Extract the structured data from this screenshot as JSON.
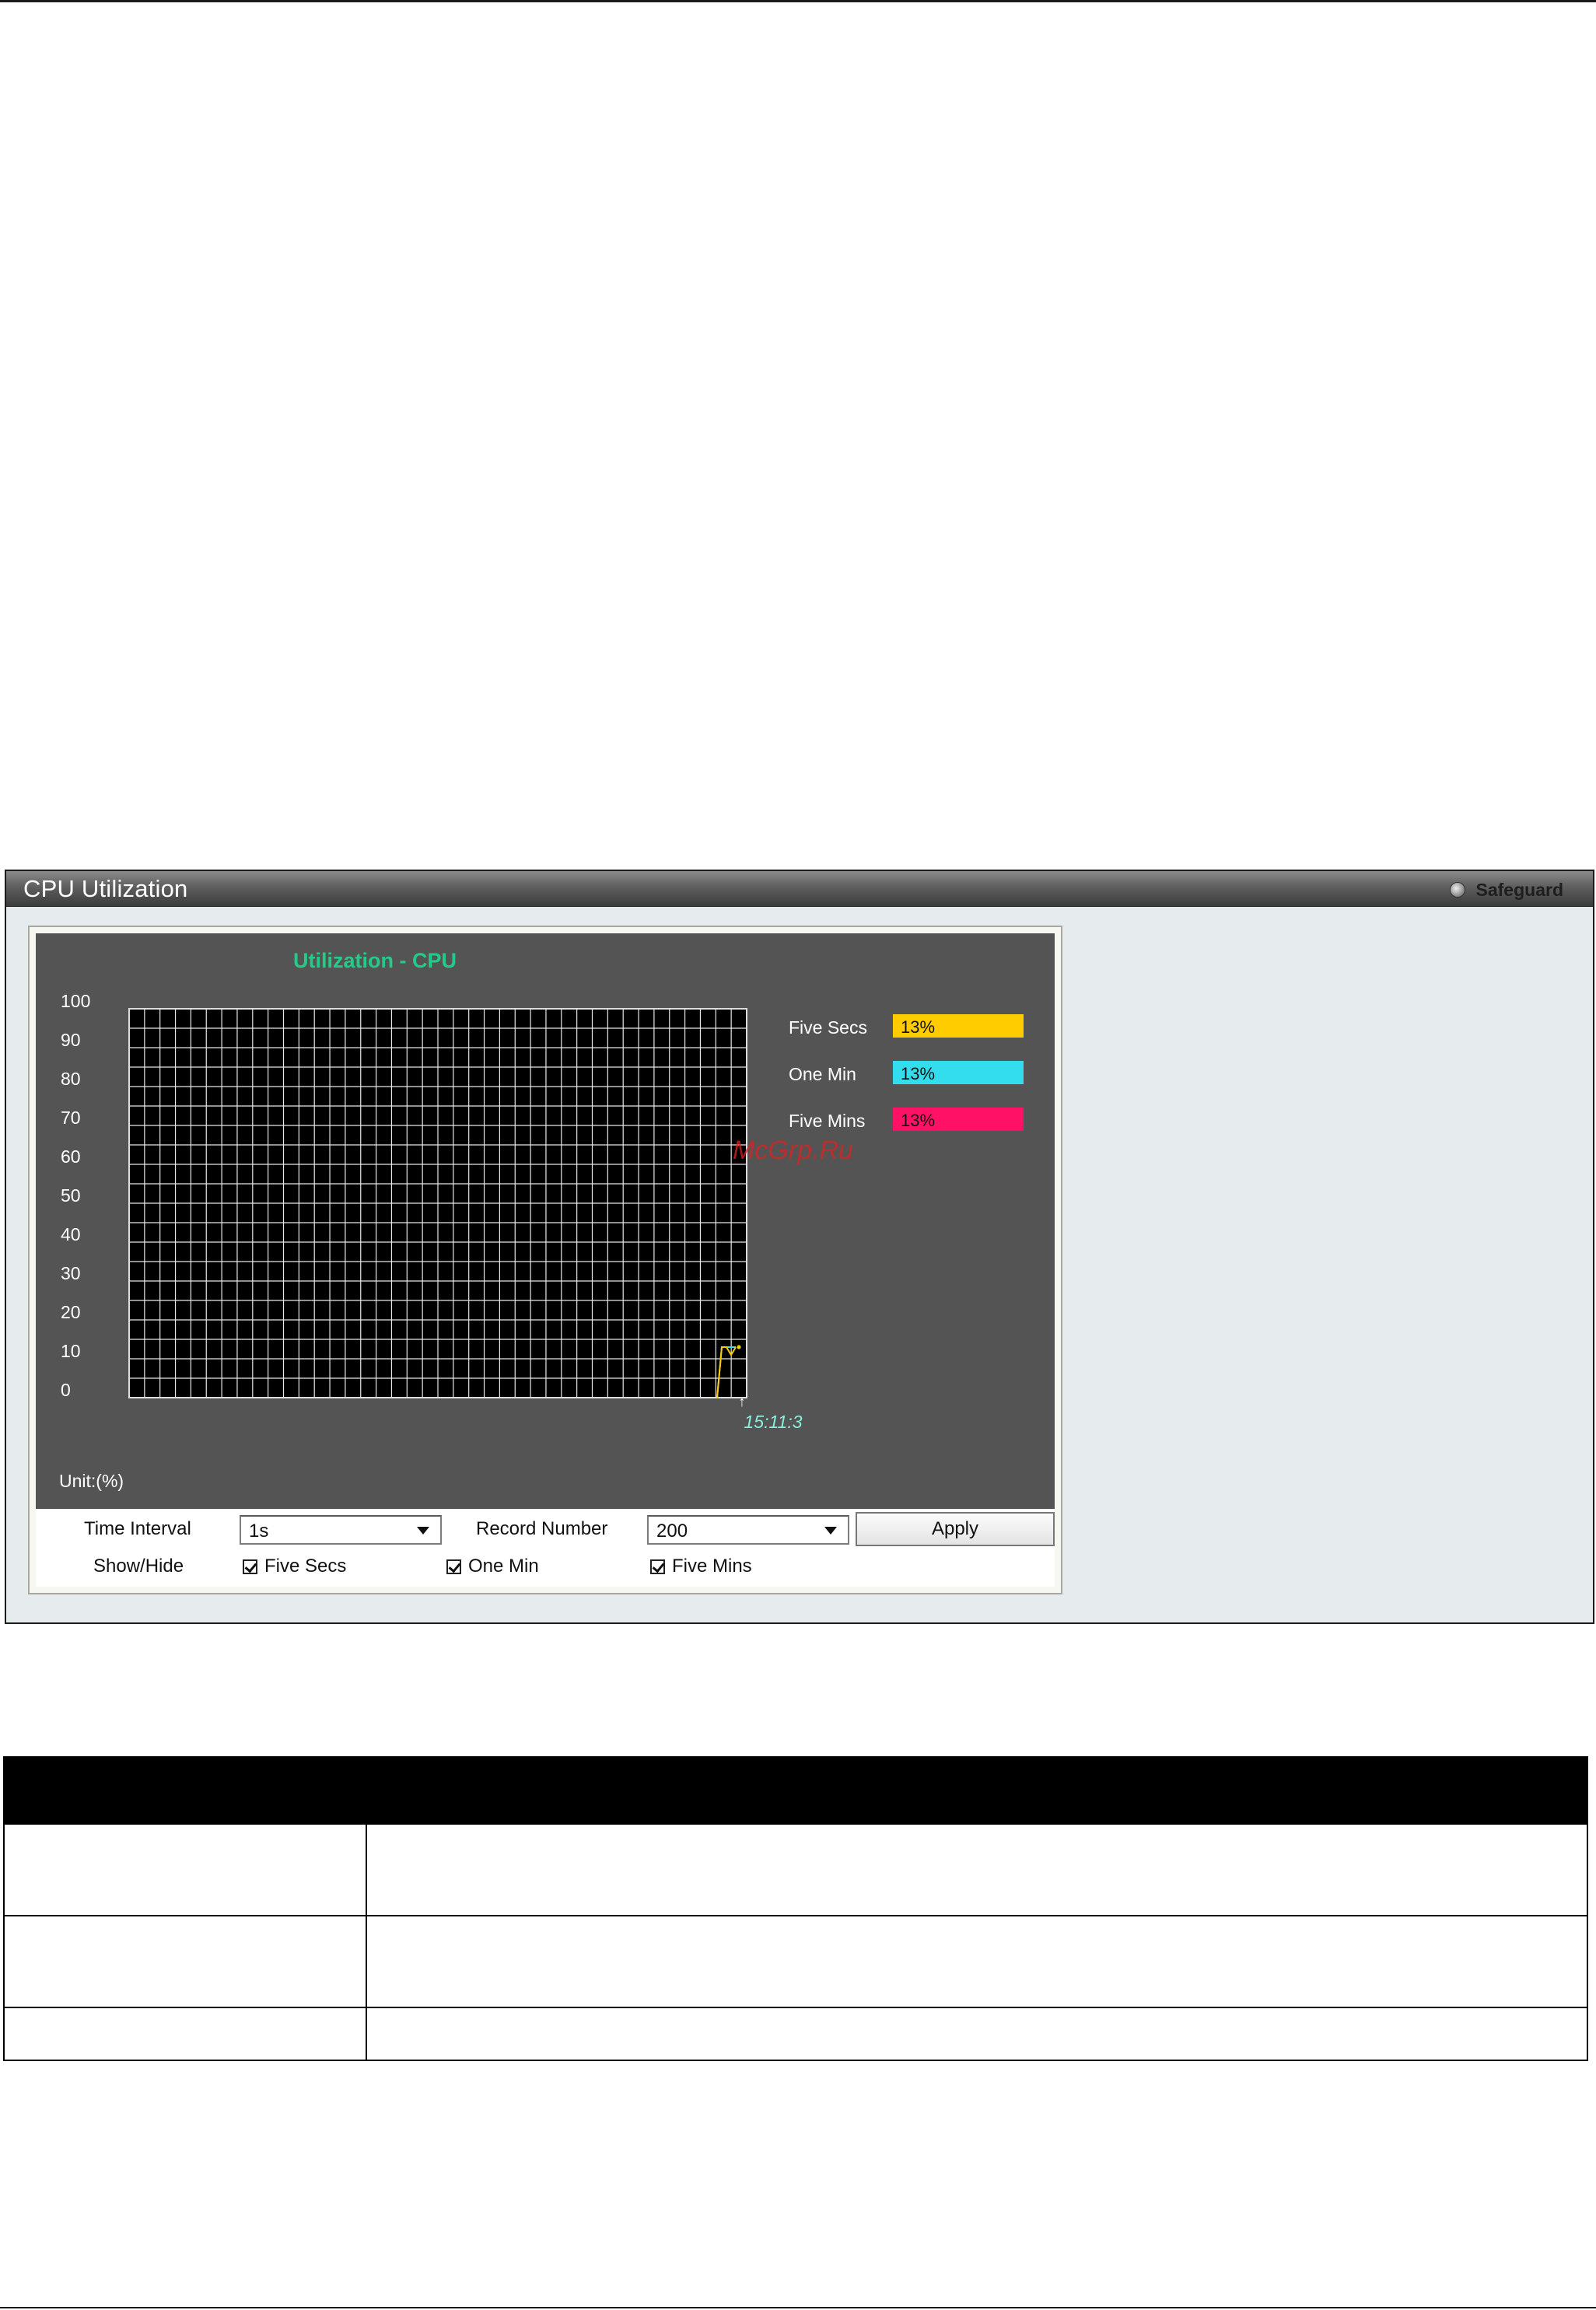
{
  "window": {
    "title": "CPU Utilization",
    "safeguard_label": "Safeguard"
  },
  "chart_data": {
    "type": "line",
    "title": "Utilization - CPU",
    "unit_label": "Unit:(%)",
    "y_ticks": [
      "100",
      "90",
      "80",
      "70",
      "60",
      "50",
      "40",
      "30",
      "20",
      "10",
      "0"
    ],
    "ylim": [
      0,
      100
    ],
    "grid": true,
    "x_time_label": "15:11:3",
    "legend_position": "right",
    "legend": [
      {
        "name": "Five Secs",
        "value_label": "13%",
        "color": "#ffcc00"
      },
      {
        "name": "One Min",
        "value_label": "13%",
        "color": "#33ddee"
      },
      {
        "name": "Five Mins",
        "value_label": "13%",
        "color": "#ff1166"
      }
    ],
    "series": [
      {
        "name": "Five Secs",
        "color": "#ffcc00",
        "values": [
          0,
          13,
          13,
          11,
          13
        ]
      },
      {
        "name": "One Min",
        "color": "#33ddee",
        "values": [
          0,
          13,
          13,
          13,
          13
        ]
      },
      {
        "name": "Five Mins",
        "color": "#ff1166",
        "values": [
          0,
          13,
          13,
          13,
          13
        ]
      }
    ],
    "watermark": "McGrp.Ru"
  },
  "controls": {
    "time_interval_label": "Time Interval",
    "time_interval_value": "1s",
    "record_number_label": "Record Number",
    "record_number_value": "200",
    "apply_label": "Apply",
    "show_hide_label": "Show/Hide",
    "check_five_secs": "Five Secs",
    "check_one_min": "One Min",
    "check_five_mins": "Five Mins"
  }
}
